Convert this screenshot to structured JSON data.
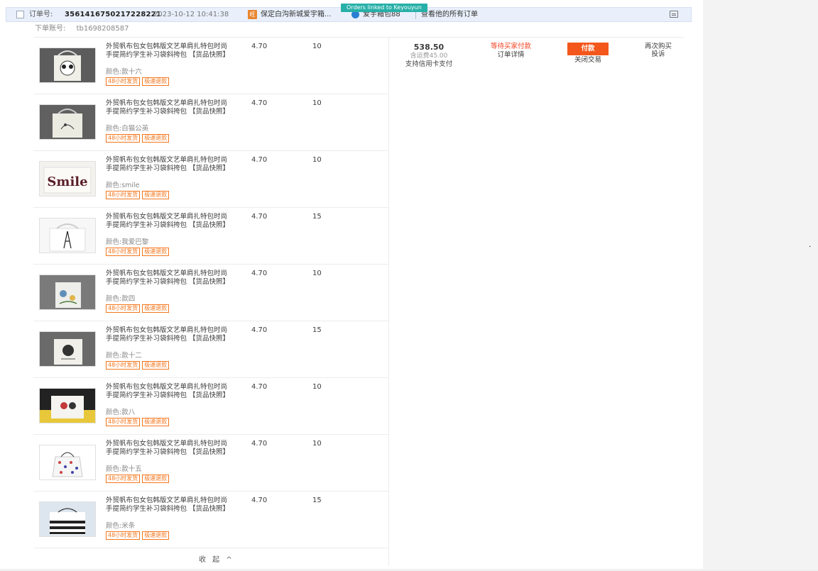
{
  "banner": {
    "linked_label": "Orders linked to Keyouyun"
  },
  "order": {
    "number_label": "订单号:",
    "number": "3561416750217228221",
    "time": "2023-10-12 10:41:38",
    "shop_icon_glyph": "旺",
    "shop_name": "保定白沟新城爱宇箱...",
    "seller_name": "爱宇箱包88",
    "view_all_label": "查看他的所有订单",
    "buyer_label": "下单账号:",
    "buyer_account": "tb1698208587",
    "total": "538.50",
    "shipping": "含运费45.00",
    "credit": "支持信用卡支付",
    "status": "等待买家付款",
    "detail_label": "订单详情",
    "pay_label": "付款",
    "close_label": "关闭交易",
    "rebuy_label": "再次购买",
    "complaint_label": "投诉",
    "collapse_label": "收 起 ^"
  },
  "colors": {
    "accent": "#f3571b",
    "status": "#f43f1f",
    "tag": "#f4761c",
    "header_bg": "#e9f0fb",
    "banner": "#27b0a8"
  },
  "items": [
    {
      "title": "外贸帆布包女包韩版文艺单肩扎特包时尚手提简约学生补习袋斜挎包 【货品快照】",
      "spec": "颜色:款十六",
      "price": "4.70",
      "qty": "10",
      "tags": [
        "48小时发货",
        "极速退款"
      ],
      "thumb": "panda-tote"
    },
    {
      "title": "外贸帆布包女包韩版文艺单肩扎特包时尚手提简约学生补习袋斜挎包 【货品快照】",
      "spec": "颜色:白猫公英",
      "price": "4.70",
      "qty": "10",
      "tags": [
        "48小时发货",
        "极速退款"
      ],
      "thumb": "cat-tote"
    },
    {
      "title": "外贸帆布包女包韩版文艺单肩扎特包时尚手提简约学生补习袋斜挎包 【货品快照】",
      "spec": "颜色:smile",
      "price": "4.70",
      "qty": "10",
      "tags": [
        "48小时发货",
        "极速退款"
      ],
      "thumb": "smile-tote"
    },
    {
      "title": "外贸帆布包女包韩版文艺单肩扎特包时尚手提简约学生补习袋斜挎包 【货品快照】",
      "spec": "颜色:我爱巴黎",
      "price": "4.70",
      "qty": "15",
      "tags": [
        "48小时发货",
        "极速退款"
      ],
      "thumb": "paris-tote"
    },
    {
      "title": "外贸帆布包女包韩版文艺单肩扎特包时尚手提简约学生补习袋斜挎包 【货品快照】",
      "spec": "颜色:款四",
      "price": "4.70",
      "qty": "10",
      "tags": [
        "48小时发货",
        "极速退款"
      ],
      "thumb": "floral-tote"
    },
    {
      "title": "外贸帆布包女包韩版文艺单肩扎特包时尚手提简约学生补习袋斜挎包 【货品快照】",
      "spec": "颜色:款十二",
      "price": "4.70",
      "qty": "15",
      "tags": [
        "48小时发货",
        "极速退款"
      ],
      "thumb": "sketch-tote"
    },
    {
      "title": "外贸帆布包女包韩版文艺单肩扎特包时尚手提简约学生补习袋斜挎包 【货品快照】",
      "spec": "颜色:款八",
      "price": "4.70",
      "qty": "10",
      "tags": [
        "48小时发货",
        "极速退款"
      ],
      "thumb": "cartoon-tote"
    },
    {
      "title": "外贸帆布包女包韩版文艺单肩扎特包时尚手提简约学生补习袋斜挎包 【货品快照】",
      "spec": "颜色:款十五",
      "price": "4.70",
      "qty": "10",
      "tags": [
        "48小时发货",
        "极速退款"
      ],
      "thumb": "heart-tote"
    },
    {
      "title": "外贸帆布包女包韩版文艺单肩扎特包时尚手提简约学生补习袋斜挎包 【货品快照】",
      "spec": "颜色:米条",
      "price": "4.70",
      "qty": "15",
      "tags": [
        "48小时发货",
        "极速退款"
      ],
      "thumb": "stripe-tote"
    }
  ],
  "thumb_text": {
    "smile": "Smile"
  }
}
